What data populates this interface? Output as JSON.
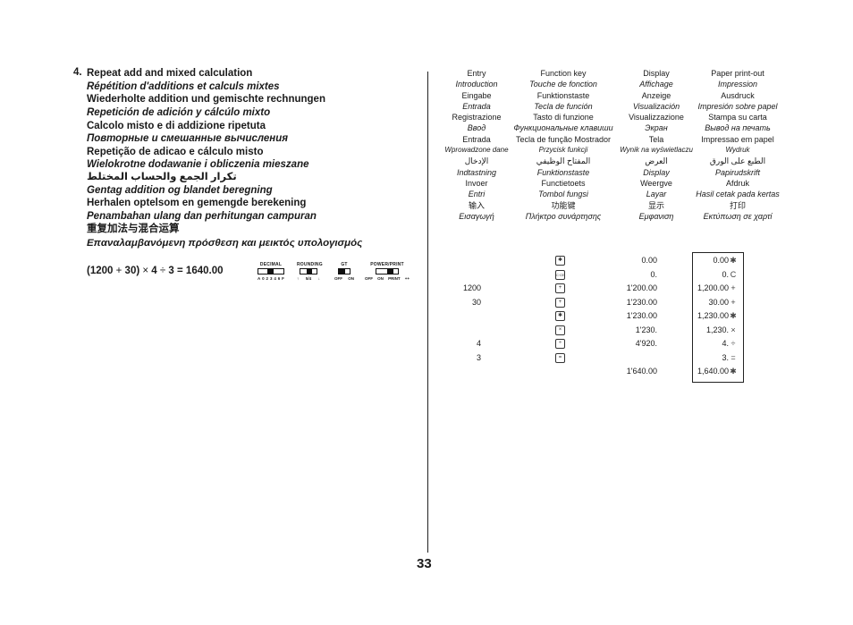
{
  "section": {
    "number": "4.",
    "titles": [
      {
        "text": "Repeat add and mixed calculation",
        "style": "normal"
      },
      {
        "text": "Répétition d'additions et calculs mixtes",
        "style": "italic"
      },
      {
        "text": "Wiederholte addition und gemischte rechnungen",
        "style": "normal"
      },
      {
        "text": "Repetición de adición y cálcúlo mixto",
        "style": "italic"
      },
      {
        "text": "Calcolo misto e di addizione ripetuta",
        "style": "normal"
      },
      {
        "text": "Повторные и смешанные вычисления",
        "style": "italic"
      },
      {
        "text": "Repetição de adicao e cálculo misto",
        "style": "normal"
      },
      {
        "text": "Wielokrotne dodawanie i obliczenia mieszane",
        "style": "italic"
      },
      {
        "text": "تكرار الجمع والحساب المختلط",
        "style": "arabic"
      },
      {
        "text": "Gentag addition og blandet beregning",
        "style": "italic"
      },
      {
        "text": "Herhalen optelsom en gemengde berekening",
        "style": "normal"
      },
      {
        "text": "Penambahan ulang dan perhitungan campuran",
        "style": "italic"
      },
      {
        "text": "重复加法与混合运算",
        "style": "normal"
      },
      {
        "text": "Επαναλαμβανόμενη πρόσθεση και μεικτός υπολογισμός",
        "style": "italic"
      }
    ]
  },
  "formula": {
    "open": "(1200",
    "plus": "+",
    "mid": "30)",
    "times": "×",
    "four": "4",
    "div": "÷",
    "rest": "3 = 1640.00"
  },
  "switches": [
    {
      "label": "DECIMAL",
      "positions": [
        "A",
        "0",
        "2",
        "3",
        "4",
        "6",
        "F"
      ],
      "selected": "2"
    },
    {
      "label": "ROUNDING",
      "positions": [
        "↑",
        "5/4",
        "↓"
      ],
      "selected": "5/4"
    },
    {
      "label": "GT",
      "positions": [
        "OFF",
        "ON"
      ],
      "selected": "OFF"
    },
    {
      "label": "POWER/PRINT",
      "positions": [
        "OFF",
        "ON",
        "PRINT",
        "++"
      ],
      "selected": "PRINT"
    }
  ],
  "header_table": {
    "rows": [
      {
        "style": "normal",
        "cells": [
          "Entry",
          "Function key",
          "Display",
          "Paper print-out"
        ]
      },
      {
        "style": "italic",
        "cells": [
          "Introduction",
          "Touche de fonction",
          "Affichage",
          "Impression"
        ]
      },
      {
        "style": "normal",
        "cells": [
          "Eingabe",
          "Funktionstaste",
          "Anzeige",
          "Ausdruck"
        ]
      },
      {
        "style": "italic",
        "cells": [
          "Entrada",
          "Tecla de función",
          "Visualización",
          "Impresión sobre papel"
        ]
      },
      {
        "style": "normal",
        "cells": [
          "Registrazione",
          "Tasto di funzione",
          "Visualizzazione",
          "Stampa su carta"
        ]
      },
      {
        "style": "italic",
        "cells": [
          "Ввод",
          "Функциональные клавиши",
          "Экран",
          "Вывод на печать"
        ]
      },
      {
        "style": "normal",
        "cells": [
          "Entrada",
          "Tecla de função Mostrador",
          "Tela",
          "Impressao em papel"
        ]
      },
      {
        "style": "italic-small",
        "cells": [
          "Wprowadzone dane",
          "Przycisk funkcji",
          "Wynik na wyświetlaczu",
          "Wydruk"
        ]
      },
      {
        "style": "arabic",
        "cells": [
          "الإدخال",
          "المفتاح الوظيفي",
          "العرض",
          "الطبع على الورق"
        ]
      },
      {
        "style": "italic",
        "cells": [
          "Indtastning",
          "Funktionstaste",
          "Display",
          "Papirudskrift"
        ]
      },
      {
        "style": "normal",
        "cells": [
          "Invoer",
          "Functietoets",
          "Weergve",
          "Afdruk"
        ]
      },
      {
        "style": "italic",
        "cells": [
          "Entri",
          "Tombol fungsi",
          "Layar",
          "Hasil cetak pada kertas"
        ]
      },
      {
        "style": "normal",
        "cells": [
          "输入",
          "功能键",
          "显示",
          "打印"
        ]
      },
      {
        "style": "italic",
        "cells": [
          "Εισαγωγή",
          "Πλήκτρο συνάρτησης",
          "Εμφανιση",
          "Εκτύπωση σε χαρτί"
        ]
      }
    ]
  },
  "calculation": {
    "rows": [
      {
        "entry": "",
        "key": "✱",
        "key_name": "total-key",
        "display": "0.00",
        "print_value": "0.00",
        "print_symbol": "✱"
      },
      {
        "entry": "",
        "key": "C·CE",
        "key_name": "clear-key",
        "display": "0.",
        "print_value": "0.",
        "print_symbol": "C"
      },
      {
        "entry": "1200",
        "key": "+",
        "key_name": "plus-key",
        "display": "1ʹ200.00",
        "print_value": "1,200.00",
        "print_symbol": "+"
      },
      {
        "entry": "30",
        "key": "+",
        "key_name": "plus-key",
        "display": "1ʹ230.00",
        "print_value": "30.00",
        "print_symbol": "+"
      },
      {
        "entry": "",
        "key": "✱",
        "key_name": "total-key",
        "display": "1ʹ230.00",
        "print_value": "1,230.00",
        "print_symbol": "✱"
      },
      {
        "entry": "",
        "key": "×",
        "key_name": "multiply-key",
        "display": "1ʹ230.",
        "print_value": "1,230.",
        "print_symbol": "×"
      },
      {
        "entry": "4",
        "key": "÷",
        "key_name": "divide-key",
        "display": "4ʹ920.",
        "print_value": "4.",
        "print_symbol": "÷"
      },
      {
        "entry": "3",
        "key": "=",
        "key_name": "equals-key",
        "display": "",
        "print_value": "3.",
        "print_symbol": "="
      },
      {
        "entry": "",
        "key": "",
        "key_name": "",
        "display": "1ʹ640.00",
        "print_value": "1,640.00",
        "print_symbol": "✱"
      }
    ]
  },
  "page_number": "33"
}
